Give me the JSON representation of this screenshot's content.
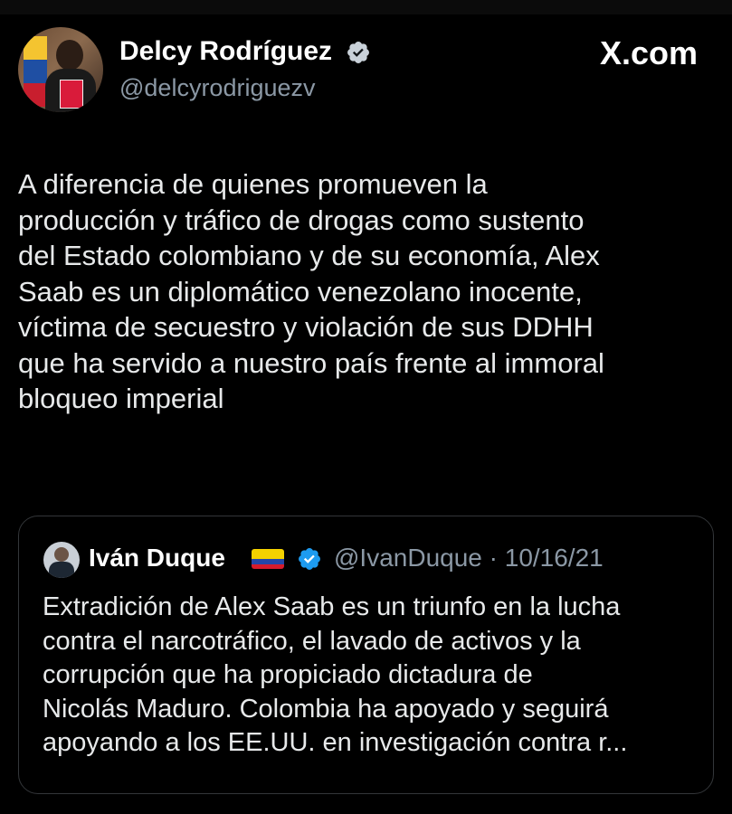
{
  "brand": "X.com",
  "author": {
    "name": "Delcy Rodríguez",
    "handle": "@delcyrodriguezv"
  },
  "tweet": {
    "lines": [
      "A diferencia de quienes promueven la",
      "producción y tráfico de drogas como sustento",
      "del Estado colombiano y de su economía, Alex",
      "Saab es un diplomático venezolano inocente,",
      "víctima de secuestro y violación de sus DDHH",
      "que ha servido a nuestro país frente al immoral",
      "bloqueo imperial"
    ]
  },
  "quote": {
    "name": "Iván Duque",
    "handle_date": "@IvanDuque · 10/16/21",
    "lines": [
      "Extradición de Alex Saab es un triunfo en la lucha",
      "contra el narcotráfico, el lavado de activos y la",
      "corrupción que ha propiciado dictadura de",
      "Nicolás Maduro. Colombia ha apoyado y seguirá",
      "apoyando a los EE.UU. en investigación contra r..."
    ]
  },
  "colors": {
    "background": "#000000",
    "verified": "#1d9bf0",
    "verified_author_badge": "#c9d1d9",
    "muted_text": "#8b98a5"
  },
  "icons": [
    "verified-badge-icon",
    "colombia-flag-icon",
    "x-logo"
  ]
}
